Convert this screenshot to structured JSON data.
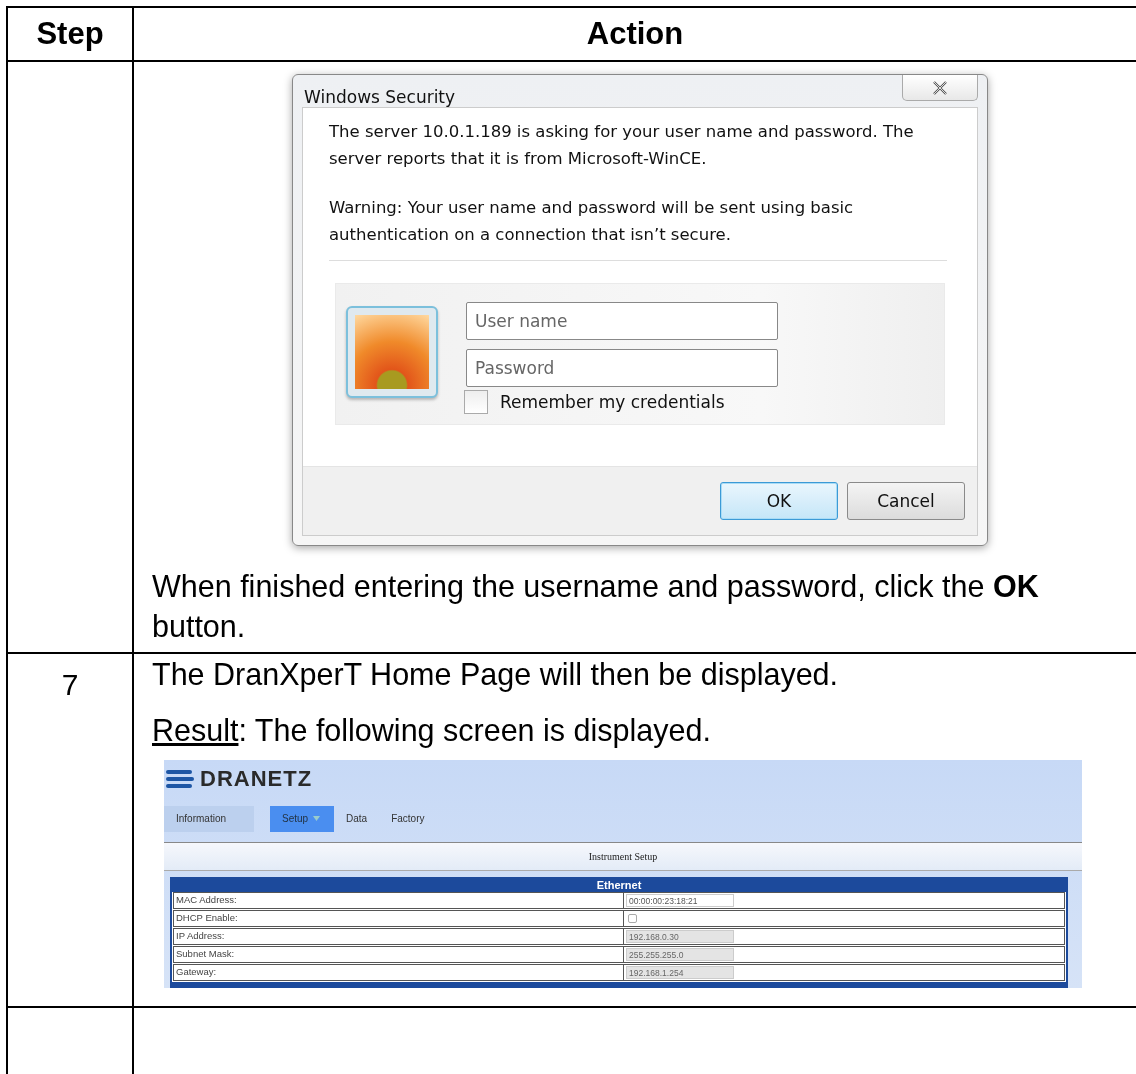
{
  "table": {
    "columns": [
      "Step",
      "Action"
    ],
    "rows": [
      {
        "kind": "dialog",
        "dialog": {
          "title": "Windows Security",
          "message": [
            "The server 10.0.1.189 is asking for your user name and password. The server reports that it is from Microsoft-WinCE.",
            "Warning: Your user name and password will be sent using basic authentication on a connection that isn’t secure."
          ],
          "fields": [
            {
              "placeholder": "User name"
            },
            {
              "placeholder": "Password"
            }
          ],
          "remember": {
            "label": "Remember my credentials",
            "checked": false
          },
          "buttons": [
            {
              "label": "OK",
              "default": true
            },
            {
              "label": "Cancel",
              "default": false
            }
          ]
        },
        "instruction": "When finished entering the username and password, click the **OK** button."
      },
      {
        "kind": "result",
        "step": "7",
        "text": "The DranXperT Home Page will then be displayed.",
        "result_label": "Result",
        "result_text": ": The following screen is displayed.",
        "screenshot": {
          "logo": "DRANETZ",
          "tabs": [
            {
              "label": "Information",
              "selected": false,
              "menu": false
            },
            {
              "label": "Setup",
              "selected": true,
              "menu": true
            },
            {
              "label": "Data",
              "selected": false,
              "menu": false
            },
            {
              "label": "Factory",
              "selected": false,
              "menu": false
            }
          ],
          "page_title": "Instrument Setup",
          "section": "Ethernet",
          "rows": [
            {
              "label": "MAC Address:",
              "kind": "text",
              "value": "00:00:00:23:18:21",
              "disabled": false
            },
            {
              "label": "DHCP Enable:",
              "kind": "checkbox",
              "checked": false
            },
            {
              "label": "IP Address:",
              "kind": "text",
              "value": "192.168.0.30",
              "disabled": true
            },
            {
              "label": "Subnet Mask:",
              "kind": "text",
              "value": "255.255.255.0",
              "disabled": true
            },
            {
              "label": "Gateway:",
              "kind": "text",
              "value": "192.168.1.254",
              "disabled": true
            }
          ]
        }
      },
      {
        "kind": "empty"
      }
    ]
  }
}
